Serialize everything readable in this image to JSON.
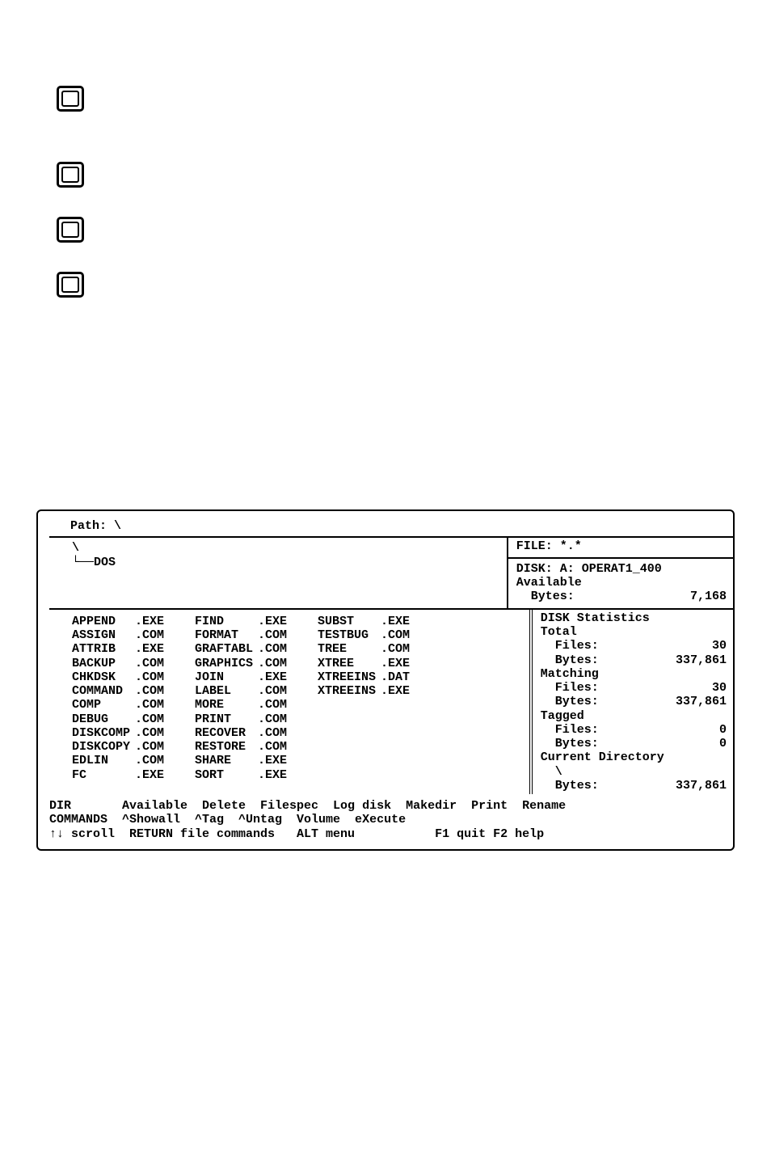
{
  "checkbox_tops": [
    106,
    200,
    268,
    336
  ],
  "path_label": "Path: \\",
  "tree_root": "\\",
  "tree_sub": "└──DOS",
  "info": {
    "file_label": "FILE: *.*",
    "disk_label": "DISK: A: OPERAT1_400",
    "avail_label": "Available",
    "avail_bytes_lab": "  Bytes:",
    "avail_bytes_val": "7,168"
  },
  "files_col1": [
    {
      "n": "APPEND",
      "e": ".EXE"
    },
    {
      "n": "ASSIGN",
      "e": ".COM"
    },
    {
      "n": "ATTRIB",
      "e": ".EXE"
    },
    {
      "n": "BACKUP",
      "e": ".COM"
    },
    {
      "n": "CHKDSK",
      "e": ".COM"
    },
    {
      "n": "COMMAND",
      "e": ".COM"
    },
    {
      "n": "COMP",
      "e": ".COM"
    },
    {
      "n": "DEBUG",
      "e": ".COM"
    },
    {
      "n": "DISKCOMP",
      "e": ".COM"
    },
    {
      "n": "DISKCOPY",
      "e": ".COM"
    },
    {
      "n": "EDLIN",
      "e": ".COM"
    },
    {
      "n": "FC",
      "e": ".EXE"
    }
  ],
  "files_col2": [
    {
      "n": "FIND",
      "e": ".EXE"
    },
    {
      "n": "FORMAT",
      "e": ".COM"
    },
    {
      "n": "GRAFTABL",
      "e": ".COM"
    },
    {
      "n": "GRAPHICS",
      "e": ".COM"
    },
    {
      "n": "JOIN",
      "e": ".EXE"
    },
    {
      "n": "LABEL",
      "e": ".COM"
    },
    {
      "n": "MORE",
      "e": ".COM"
    },
    {
      "n": "PRINT",
      "e": ".COM"
    },
    {
      "n": "RECOVER",
      "e": ".COM"
    },
    {
      "n": "RESTORE",
      "e": ".COM"
    },
    {
      "n": "SHARE",
      "e": ".EXE"
    },
    {
      "n": "SORT",
      "e": ".EXE"
    }
  ],
  "files_col3": [
    {
      "n": "SUBST",
      "e": ".EXE"
    },
    {
      "n": "TESTBUG",
      "e": ".COM"
    },
    {
      "n": "TREE",
      "e": ".COM"
    },
    {
      "n": "XTREE",
      "e": ".EXE"
    },
    {
      "n": "XTREEINS",
      "e": ".DAT"
    },
    {
      "n": "XTREEINS",
      "e": ".EXE"
    }
  ],
  "stats": {
    "header": "DISK Statistics",
    "total": "Total",
    "total_files_lab": "  Files:",
    "total_files_val": "30",
    "total_bytes_lab": "  Bytes:",
    "total_bytes_val": "337,861",
    "matching": "Matching",
    "match_files_lab": "  Files:",
    "match_files_val": "30",
    "match_bytes_lab": "  Bytes:",
    "match_bytes_val": "337,861",
    "tagged": "Tagged",
    "tag_files_lab": "  Files:",
    "tag_files_val": "0",
    "tag_bytes_lab": "  Bytes:",
    "tag_bytes_val": "0",
    "curdir": "Current Directory",
    "curdir_path": "  \\",
    "curdir_bytes_lab": "  Bytes:",
    "curdir_bytes_val": "337,861"
  },
  "cmd1": "DIR       Available  Delete  Filespec  Log disk  Makedir  Print  Rename",
  "cmd2": "COMMANDS  ^Showall  ^Tag  ^Untag  Volume  eXecute",
  "cmd3": "↑↓ scroll  RETURN file commands   ALT menu           F1 quit F2 help"
}
